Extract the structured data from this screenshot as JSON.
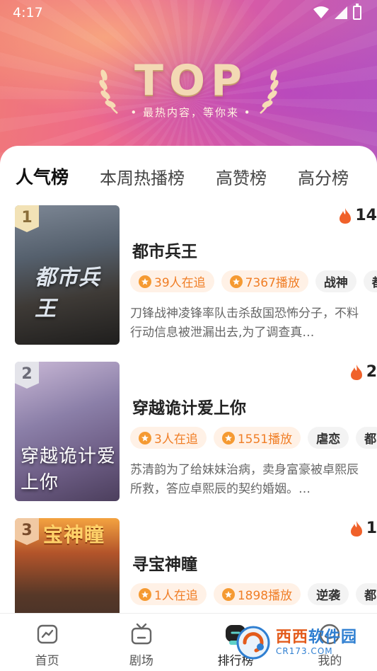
{
  "status_bar": {
    "time": "4:17"
  },
  "header": {
    "badge_title": "TOP",
    "badge_subtitle": "• 最热内容，等你来 •"
  },
  "tabs": [
    {
      "label": "人气榜",
      "active": true
    },
    {
      "label": "本周热播榜",
      "active": false
    },
    {
      "label": "高赞榜",
      "active": false
    },
    {
      "label": "高分榜",
      "active": false
    }
  ],
  "items": [
    {
      "rank": "1",
      "poster_text": "都市兵王",
      "heat": "14",
      "title": "都市兵王",
      "followers": "39人在追",
      "plays": "7367播放",
      "genres": [
        "战神",
        "都"
      ],
      "description": "刀锋战神凌锋率队击杀敌国恐怖分子，不料行动信息被泄漏出去,为了调查真…"
    },
    {
      "rank": "2",
      "poster_text": "穿越诡计爱上你",
      "heat": "2",
      "title": "穿越诡计爱上你",
      "followers": "3人在追",
      "plays": "1551播放",
      "genres": [
        "虐恋",
        "都"
      ],
      "description": "苏清韵为了给妹妹治病，卖身富豪被卓熙辰所救，答应卓熙辰的契约婚姻。…"
    },
    {
      "rank": "3",
      "poster_text": "宝神瞳",
      "heat": "1",
      "title": "寻宝神瞳",
      "followers": "1人在追",
      "plays": "1898播放",
      "genres": [
        "逆袭",
        "都"
      ],
      "description": ""
    }
  ],
  "bottom_nav": [
    {
      "label": "首页",
      "icon": "home-icon"
    },
    {
      "label": "剧场",
      "icon": "tv-icon"
    },
    {
      "label": "排行榜",
      "icon": "ranking-icon",
      "active": true
    },
    {
      "label": "我的",
      "icon": "profile-icon"
    }
  ],
  "watermark": {
    "brand_a": "西西",
    "brand_b": "软件园",
    "url": "CR173.COM"
  },
  "colors": {
    "accent_orange": "#f07e26",
    "tab_underline": "#5ed0c8",
    "fire": "#f0612a"
  }
}
